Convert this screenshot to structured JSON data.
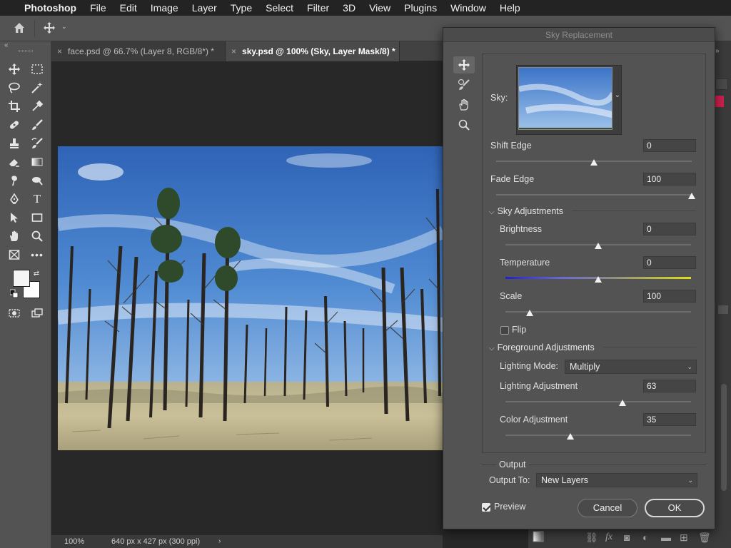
{
  "menubar": {
    "app_name": "Photoshop",
    "items": [
      "File",
      "Edit",
      "Image",
      "Layer",
      "Type",
      "Select",
      "Filter",
      "3D",
      "View",
      "Plugins",
      "Window",
      "Help"
    ]
  },
  "tabs": [
    {
      "label": "face.psd @ 66.7% (Layer 8, RGB/8*) *",
      "active": false
    },
    {
      "label": "sky.psd @ 100% (Sky, Layer Mask/8) *",
      "active": true
    }
  ],
  "status": {
    "zoom": "100%",
    "doc_info": "640 px x 427 px (300 ppi)"
  },
  "dialog": {
    "title": "Sky Replacement",
    "sky_label": "Sky:",
    "shift_edge": {
      "label": "Shift Edge",
      "value": "0",
      "fraction": 0.5
    },
    "fade_edge": {
      "label": "Fade Edge",
      "value": "100",
      "fraction": 1.0
    },
    "sky_adjustments": {
      "title": "Sky Adjustments",
      "brightness": {
        "label": "Brightness",
        "value": "0",
        "fraction": 0.5
      },
      "temperature": {
        "label": "Temperature",
        "value": "0",
        "fraction": 0.5
      },
      "scale": {
        "label": "Scale",
        "value": "100",
        "fraction": 0.13
      },
      "flip": {
        "label": "Flip",
        "checked": false
      }
    },
    "foreground_adjustments": {
      "title": "Foreground Adjustments",
      "lighting_mode": {
        "label": "Lighting Mode:",
        "value": "Multiply"
      },
      "lighting_adjustment": {
        "label": "Lighting Adjustment",
        "value": "63",
        "fraction": 0.63
      },
      "color_adjustment": {
        "label": "Color Adjustment",
        "value": "35",
        "fraction": 0.35
      }
    },
    "output": {
      "title": "Output",
      "output_to_label": "Output To:",
      "output_to_value": "New Layers"
    },
    "preview": {
      "label": "Preview",
      "checked": true
    },
    "cancel_label": "Cancel",
    "ok_label": "OK"
  }
}
